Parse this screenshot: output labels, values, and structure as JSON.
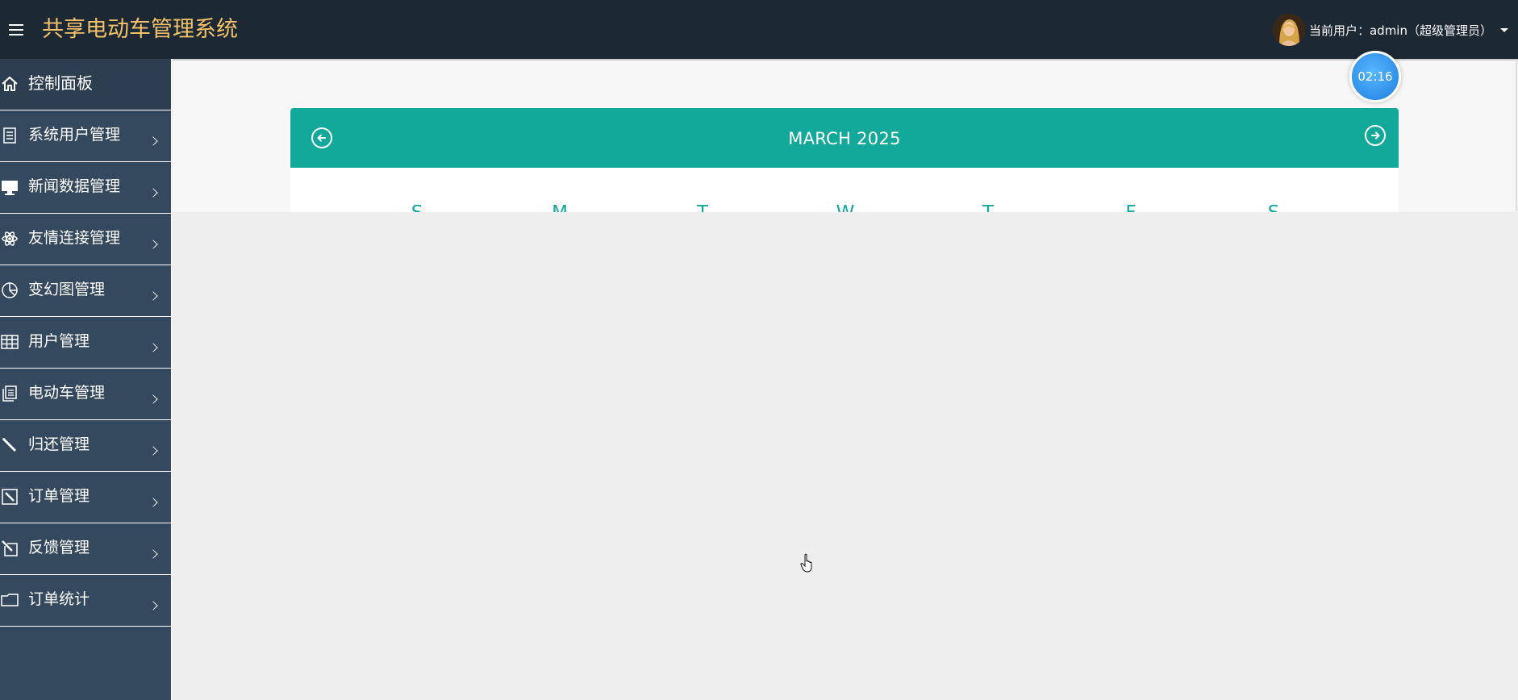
{
  "app": {
    "title": "共享电动车管理系统"
  },
  "header": {
    "user_label": "当前用户：admin（超级管理员）",
    "menu_icon": "hamburger-icon",
    "avatar_icon": "user-avatar"
  },
  "sidebar": {
    "items": [
      {
        "label": "控制面板",
        "icon": "home-icon",
        "active": true
      },
      {
        "label": "系统用户管理",
        "icon": "document-list-icon"
      },
      {
        "label": "新闻数据管理",
        "icon": "monitor-icon"
      },
      {
        "label": "友情连接管理",
        "icon": "atom-icon"
      },
      {
        "label": "变幻图管理",
        "icon": "pie-chart-icon"
      },
      {
        "label": "用户管理",
        "icon": "table-grid-icon"
      },
      {
        "label": "电动车管理",
        "icon": "stacked-pages-icon"
      },
      {
        "label": "归还管理",
        "icon": "pencil-icon"
      },
      {
        "label": "订单管理",
        "icon": "edit-square-icon"
      },
      {
        "label": "反馈管理",
        "icon": "edit-note-icon"
      },
      {
        "label": "订单统计",
        "icon": "folder-icon"
      }
    ]
  },
  "calendar": {
    "title": "MARCH 2025",
    "prev_icon": "arrow-left-circle-icon",
    "next_icon": "arrow-right-circle-icon",
    "weekdays": [
      "S",
      "M",
      "T",
      "W",
      "T",
      "F",
      "S"
    ]
  },
  "timer": {
    "value": "02:16"
  },
  "colors": {
    "topbar": "#1c2935",
    "brand": "#f3c16a",
    "sidebar": "#34495e",
    "accent": "#12a89a",
    "badge": "#2f8fe8"
  }
}
